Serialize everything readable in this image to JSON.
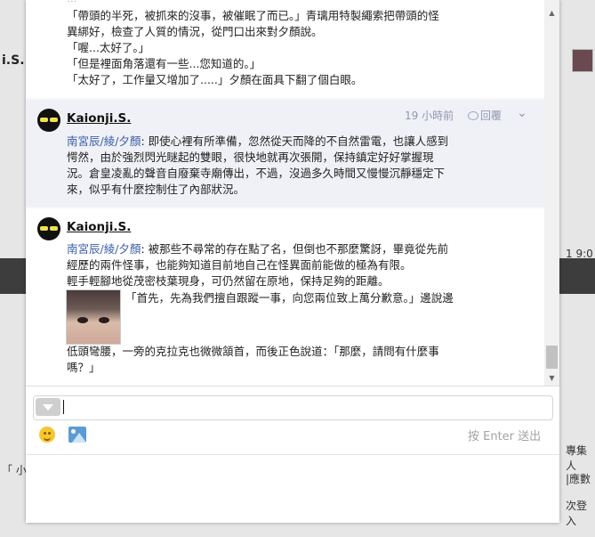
{
  "background": {
    "left_name": "i.S.",
    "left_quote": "「 小",
    "right_time": "1 9:0",
    "right_texts": [
      "專集人",
      "|應數",
      "次登入"
    ]
  },
  "messages": [
    {
      "lines": [
        "「帶頭的半死，被抓來的沒事，被催眠了而已。」青璃用特製繩索把帶頭的怪",
        "異綁好，檢查了人質的情況，從門口出來對夕顏說。",
        "「喔...太好了。」",
        "「但是裡面角落還有一些...您知道的。」",
        "「太好了，工作量又增加了.....」夕顏在面具下翻了個白眼。"
      ]
    },
    {
      "author": "Kaionji.S.",
      "time": "19 小時前",
      "reply_label": "回覆",
      "tag": "南宮辰/綾/夕顏",
      "text_lines": [
        ": 即使心裡有所準備，忽然從天而降的不自然雷電，也讓人感到",
        "愕然，由於強烈閃光瞇起的雙眼，很快地就再次張開，保持鎮定好好掌握現",
        "況。倉皇凌亂的聲音自廢棄寺廟傳出，不過，沒過多久時間又慢慢沉靜穩定下",
        "來，似乎有什麼控制住了內部狀況。"
      ]
    },
    {
      "author": "Kaionji.S.",
      "tag": "南宮辰/綾/夕顏",
      "text_lines": [
        ": 被那些不尋常的存在點了名，但倒也不那麼驚訝，畢竟從先前",
        "經歷的兩件怪事，也能夠知道目前地自己在怪異面前能做的極為有限。",
        "輕手輕腳地從茂密枝葉現身，可仍然留在原地，保持足夠的距離。"
      ],
      "quote_line": "「首先，先為我們擅自跟蹤一事，向您兩位致上萬分歉意。」邊說邊",
      "tail_lines": [
        "低頭彎腰，一旁的克拉克也微微頷首，而後正色說道：「那麼，請問有什麼事",
        "嗎？」"
      ]
    }
  ],
  "composer": {
    "input_value": "",
    "hint": "按 Enter 送出",
    "emoji_icon": "smiley-icon",
    "photo_icon": "image-icon"
  }
}
